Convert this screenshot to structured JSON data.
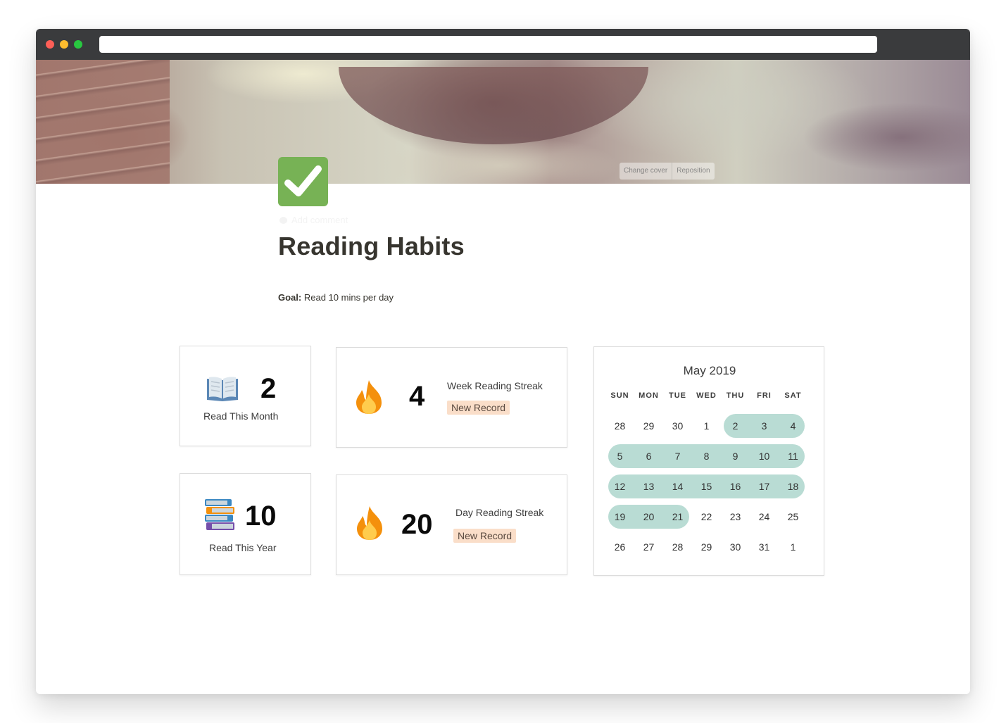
{
  "browser": {
    "url": ""
  },
  "cover": {
    "change_cover_label": "Change cover",
    "reposition_label": "Reposition"
  },
  "page": {
    "icon": "check-mark-icon",
    "add_comment_label": "Add comment",
    "title": "Reading Habits",
    "goal_label": "Goal:",
    "goal_text": "Read 10 mins per day"
  },
  "stats": {
    "month": {
      "icon": "open-book-icon",
      "value": "2",
      "label": "Read This Month"
    },
    "year": {
      "icon": "books-icon",
      "value": "10",
      "label": "Read This Year"
    },
    "week_streak": {
      "icon": "fire-icon",
      "value": "4",
      "title": "Week Reading Streak",
      "badge": "New Record"
    },
    "day_streak": {
      "icon": "fire-icon",
      "value": "20",
      "title": "Day Reading Streak",
      "badge": "New Record"
    }
  },
  "calendar": {
    "title": "May 2019",
    "weekdays": [
      "SUN",
      "MON",
      "TUE",
      "WED",
      "THU",
      "FRI",
      "SAT"
    ],
    "weeks": [
      [
        "28",
        "29",
        "30",
        "1",
        "2",
        "3",
        "4"
      ],
      [
        "5",
        "6",
        "7",
        "8",
        "9",
        "10",
        "11"
      ],
      [
        "12",
        "13",
        "14",
        "15",
        "16",
        "17",
        "18"
      ],
      [
        "19",
        "20",
        "21",
        "22",
        "23",
        "24",
        "25"
      ],
      [
        "26",
        "27",
        "28",
        "29",
        "30",
        "31",
        "1"
      ]
    ],
    "highlighted_range": {
      "start": "May 2",
      "end": "May 21"
    },
    "highlight_color": "#b9dcd4"
  },
  "colors": {
    "badge_bg": "#fadec9",
    "icon_green": "#77b255",
    "title_text": "#37352f"
  }
}
